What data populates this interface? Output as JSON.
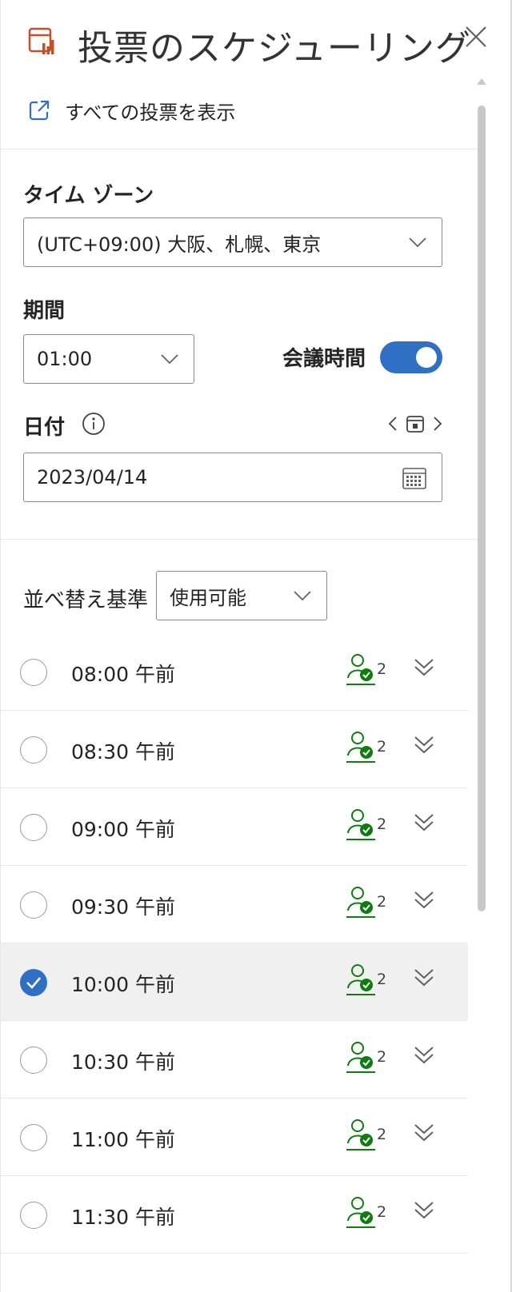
{
  "header": {
    "title": "投票のスケジューリング",
    "view_all_label": "すべての投票を表示"
  },
  "form": {
    "timezone": {
      "label": "タイム ゾーン",
      "value": "(UTC+09:00) 大阪、札幌、東京"
    },
    "duration": {
      "label": "期間",
      "value": "01:00"
    },
    "meeting_time": {
      "label": "会議時間",
      "enabled": true
    },
    "date": {
      "label": "日付",
      "value": "2023/04/14"
    },
    "sort": {
      "label": "並べ替え基準",
      "value": "使用可能"
    }
  },
  "slots": [
    {
      "time": "08:00 午前",
      "count": "2",
      "selected": false
    },
    {
      "time": "08:30 午前",
      "count": "2",
      "selected": false
    },
    {
      "time": "09:00 午前",
      "count": "2",
      "selected": false
    },
    {
      "time": "09:30 午前",
      "count": "2",
      "selected": false
    },
    {
      "time": "10:00 午前",
      "count": "2",
      "selected": true
    },
    {
      "time": "10:30 午前",
      "count": "2",
      "selected": false
    },
    {
      "time": "11:00 午前",
      "count": "2",
      "selected": false
    },
    {
      "time": "11:30 午前",
      "count": "2",
      "selected": false
    }
  ],
  "colors": {
    "accent": "#2f6fc4",
    "title_icon": "#c4502a",
    "available_green": "#107c10"
  },
  "icons": {
    "title": "poll-calendar-icon",
    "close": "close-icon",
    "view_all": "open-external-icon",
    "info": "info-icon",
    "calendar": "calendar-icon",
    "attendee": "attendee-available-icon",
    "expand": "double-chevron-down-icon"
  }
}
